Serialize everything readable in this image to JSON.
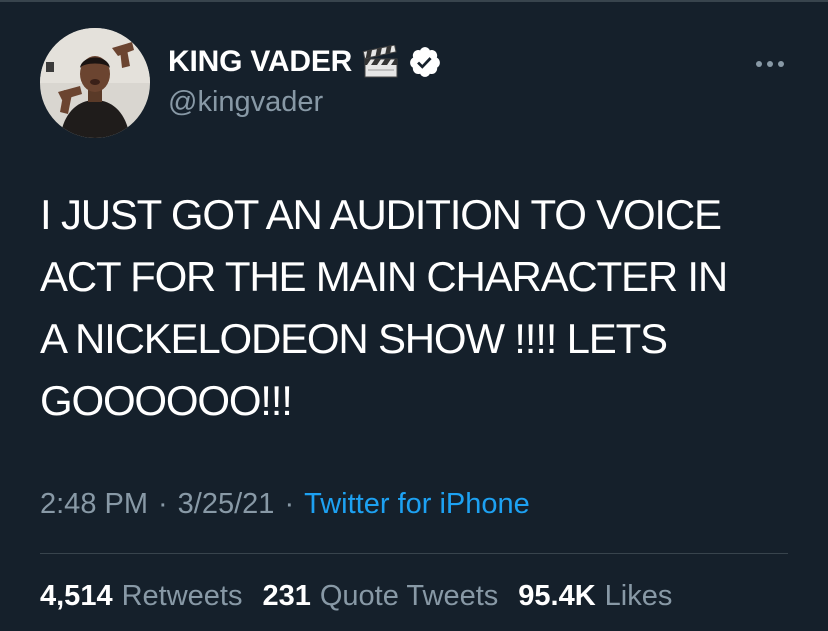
{
  "tweet": {
    "author": {
      "display_name": "KING VADER",
      "handle": "@kingvader",
      "verified": true,
      "name_emoji": "clapper-board-icon"
    },
    "text": "I JUST GOT AN AUDITION TO VOICE\nACT FOR THE MAIN CHARACTER IN\nA NICKELODEON SHOW !!!! LETS\nGOOOOOO!!!",
    "time": "2:48 PM",
    "date": "3/25/21",
    "separator": "·",
    "source": "Twitter for iPhone",
    "stats": {
      "retweets_count": "4,514",
      "retweets_label": "Retweets",
      "quotes_count": "231",
      "quotes_label": "Quote Tweets",
      "likes_count": "95.4K",
      "likes_label": "Likes"
    }
  },
  "colors": {
    "background": "#15202b",
    "primary_text": "#ffffff",
    "secondary_text": "#8899a6",
    "link": "#1da1f2",
    "divider": "#38444d"
  }
}
